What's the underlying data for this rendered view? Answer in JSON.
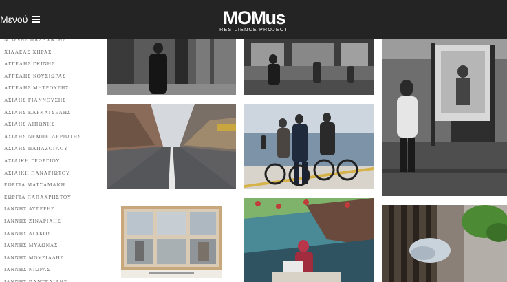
{
  "header": {
    "menu_label": "Μενού",
    "logo_title": "MOMus",
    "logo_subtitle": "RESILIENCE PROJECT"
  },
  "photographers": [
    "ΝΤΩΝΗΣ ΠΑΣΒΑΝΤΗΣ",
    "ΧΙΛΛΕΑΣ ΧΗΡΑΣ",
    "ΑΓΓΕΛΗΣ ΓΚΙΝΗΣ",
    "ΑΓΓΕΛΗΣ ΚΟΥΣΙΩΡΑΣ",
    "ΑΓΓΕΛΗΣ ΜΗΤΡΟΥΣΗΣ",
    "ΑΣΙΑΗΣ ΓΙΑΝΝΟΥΣΗΣ",
    "ΑΣΙΑΗΣ ΚΑΡΚΑΤΣΕΛΗΣ",
    "ΑΣΙΑΗΣ ΛΙΠΩΝΗΣ",
    "ΑΣΙΑΗΣ ΝΕΜΠΕΓΛΕΡΙΩΤΗΣ",
    "ΑΣΙΑΗΣ ΠΑΠΑΖΟΓΛΟΥ",
    "ΑΣΙΑΙΚΗ ΓΕΩΡΓΙΟΥ",
    "ΑΣΙΑΙΚΗ ΠΑΝΑΓΙΩΤΟΥ",
    "ΕΩΡΓΙΑ ΜΑΤΣΑΜΑΚΗ",
    "ΕΩΡΓΙΑ ΠΑΠΑΧΡΗΣΤΟΥ",
    "ΙΑΝΝΗΣ ΑΥΓΕΡΗΣ",
    "ΙΑΝΝΗΣ ΖΙΝΑΡΙΑΗΣ",
    "ΙΑΝΝΗΣ ΛΙΑΚΟΣ",
    "ΙΑΝΝΗΣ ΜΥΛΩΝΑΣ",
    "ΙΑΝΝΗΣ ΜΟΥΣΙΑΔΗΣ",
    "ΙΑΝΝΗΣ ΝΙΩΡΑΣ",
    "ΙΑΝΝΗΣ ΠΑΝΤΕΛΙΑΗΣ"
  ],
  "colors": {
    "header_bg": "#242424",
    "name_text": "#666666",
    "page_bg": "#ffffff"
  }
}
